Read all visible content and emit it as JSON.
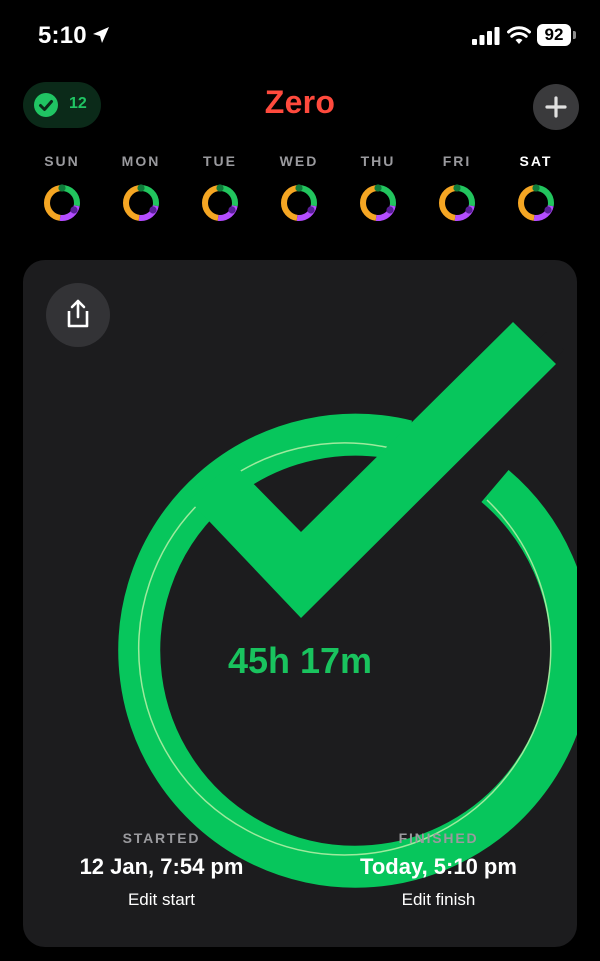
{
  "status_bar": {
    "time": "5:10",
    "battery": "92"
  },
  "header": {
    "streak_count": "12",
    "title": "Zero"
  },
  "week": [
    {
      "day": "SUN",
      "active": false
    },
    {
      "day": "MON",
      "active": false
    },
    {
      "day": "TUE",
      "active": false
    },
    {
      "day": "WED",
      "active": false
    },
    {
      "day": "THU",
      "active": false
    },
    {
      "day": "FRI",
      "active": false
    },
    {
      "day": "SAT",
      "active": true
    }
  ],
  "ring_colors": {
    "green": "#22c55e",
    "purple": "#b44dff",
    "orange": "#f5a623",
    "dark_green": "#0f7a3a"
  },
  "fast": {
    "elapsed": "45h 17m",
    "started_label": "STARTED",
    "started_value": "12 Jan, 7:54 pm",
    "edit_start": "Edit start",
    "finished_label": "FINISHED",
    "finished_value": "Today, 5:10 pm",
    "edit_finish": "Edit finish",
    "accent": "#07c65c"
  }
}
